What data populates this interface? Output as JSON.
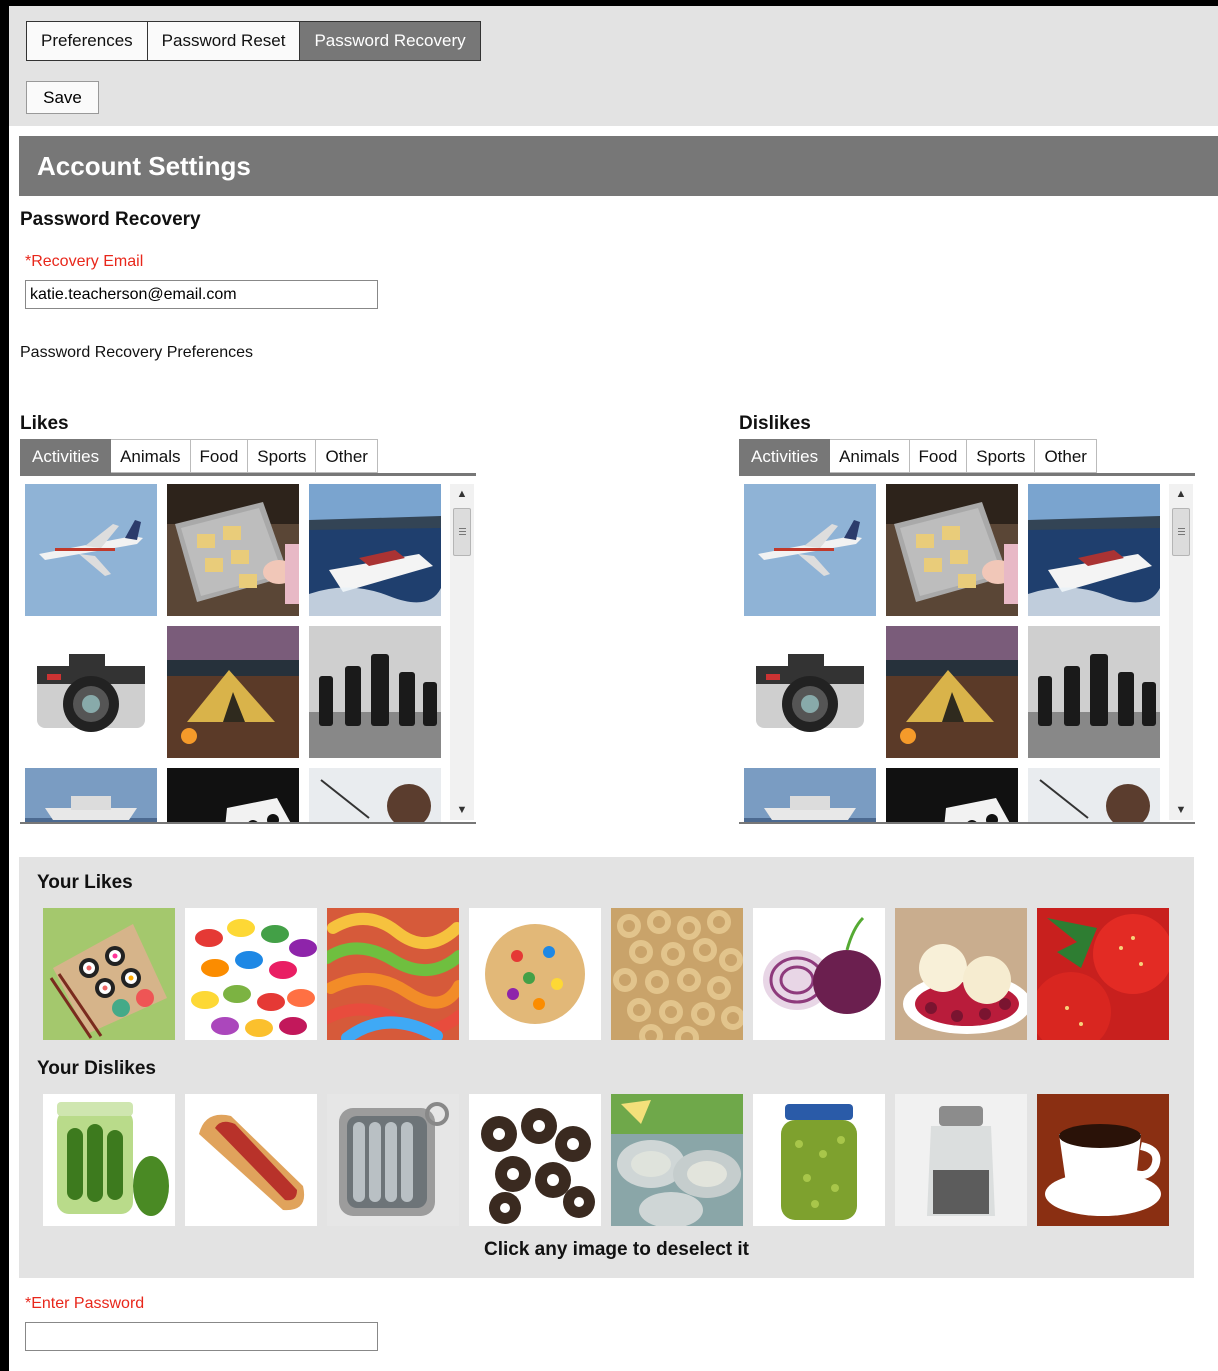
{
  "toolbar": {
    "tabs": [
      {
        "label": "Preferences",
        "active": false
      },
      {
        "label": "Password Reset",
        "active": false
      },
      {
        "label": "Password Recovery",
        "active": true
      }
    ],
    "save_label": "Save"
  },
  "header": {
    "title": "Account Settings"
  },
  "recovery": {
    "section_title": "Password Recovery",
    "email_label": "*Recovery Email",
    "email_value": "katie.teacherson@email.com",
    "prefs_label": "Password Recovery Preferences"
  },
  "likes_picker": {
    "title": "Likes",
    "tabs": [
      "Activities",
      "Animals",
      "Food",
      "Sports",
      "Other"
    ],
    "active_tab": "Activities"
  },
  "dislikes_picker": {
    "title": "Dislikes",
    "tabs": [
      "Activities",
      "Animals",
      "Food",
      "Sports",
      "Other"
    ],
    "active_tab": "Activities"
  },
  "activity_images": [
    "airplane",
    "baking-tray",
    "speedboat",
    "camera",
    "tent-campsite",
    "chess-pieces",
    "cruise-ship",
    "dice",
    "fishing"
  ],
  "your_likes": {
    "title": "Your Likes",
    "images": [
      "sushi",
      "jelly-beans",
      "gummy-worms",
      "cookie",
      "cereal-rings",
      "red-onion",
      "ice-cream",
      "strawberries"
    ]
  },
  "your_dislikes": {
    "title": "Your Dislikes",
    "images": [
      "pickles",
      "hot-dog",
      "sardines",
      "black-olives",
      "oysters",
      "relish-jar",
      "pepper-shaker",
      "coffee-cup"
    ]
  },
  "deselect_note": "Click any image to deselect it",
  "password": {
    "label": "*Enter Password",
    "value": ""
  },
  "colors": {
    "active_tab": "#777777",
    "header": "#777777",
    "required_label": "#e8271b",
    "panel_bg": "#e3e3e3"
  }
}
